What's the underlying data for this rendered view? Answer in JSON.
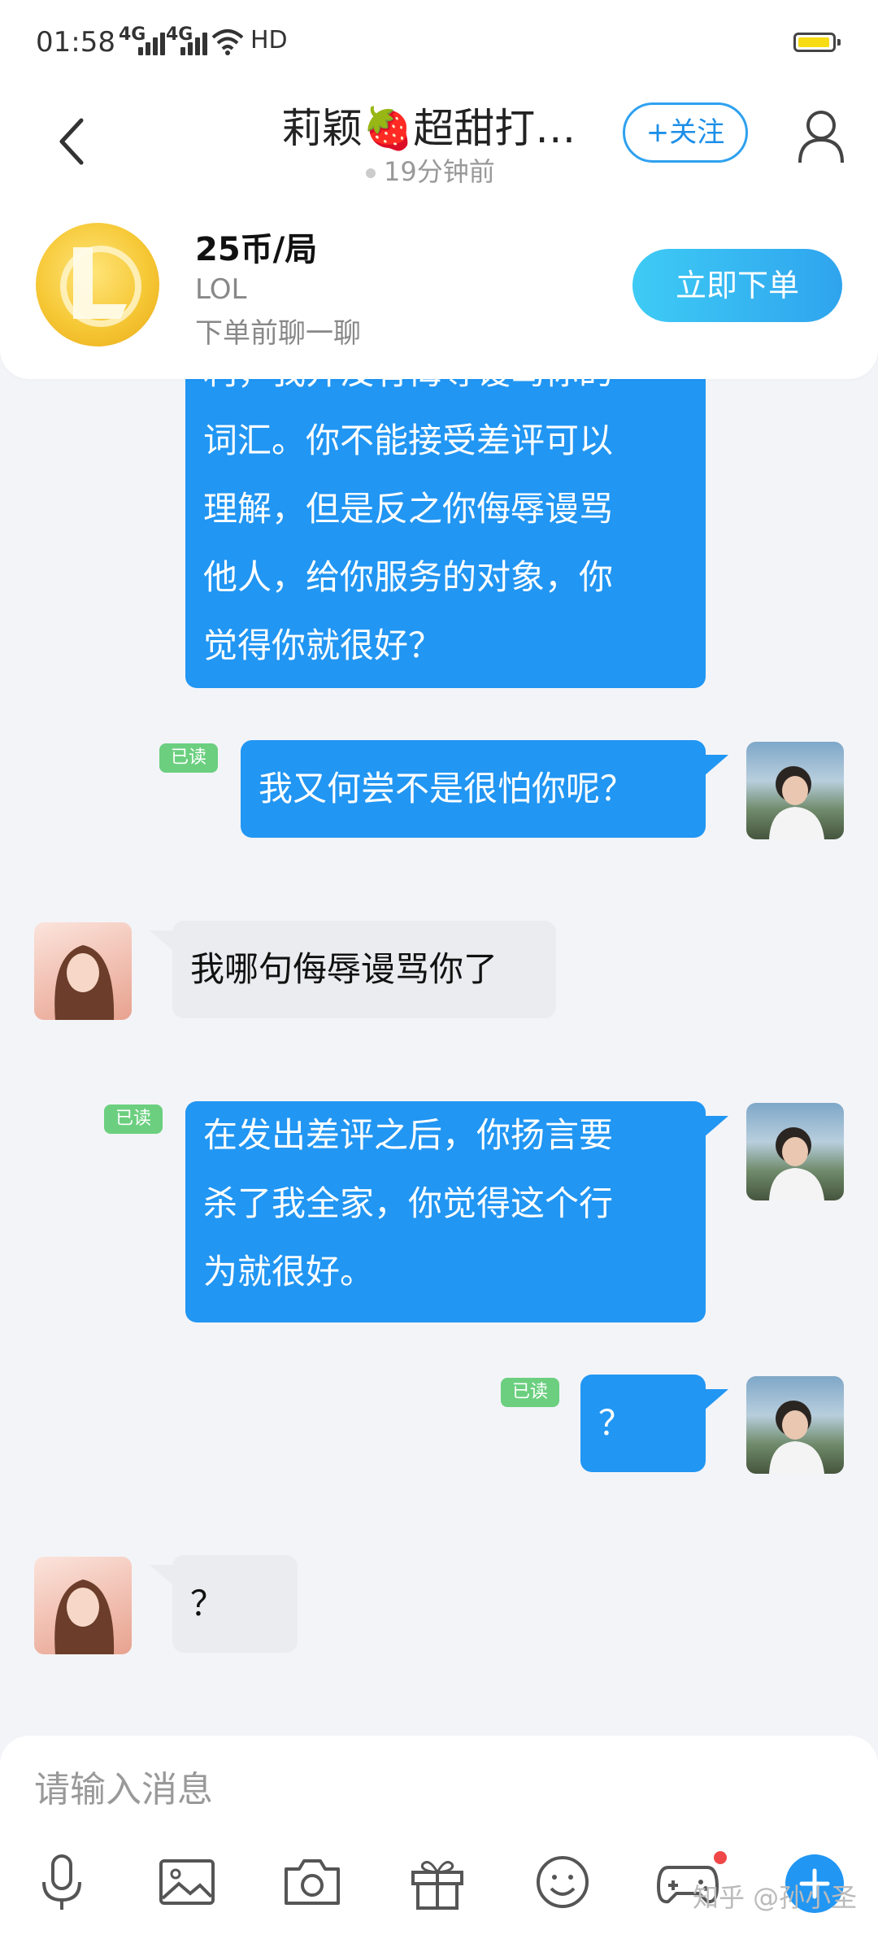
{
  "status_bar": {
    "time": "01:58",
    "network_1": "4G",
    "network_2": "4G",
    "hd": "HD"
  },
  "header": {
    "title": "莉颖🍓超甜打…",
    "last_seen": "19分钟前",
    "follow_label": "+关注"
  },
  "order_card": {
    "price": "25币/局",
    "game": "LOL",
    "hint": "下单前聊一聊",
    "order_button": "立即下单"
  },
  "messages": [
    {
      "sender": "me",
      "lines": [
        "利，我并没有侮辱谩骂你的",
        "词汇。你不能接受差评可以",
        "理解，但是反之你侮辱谩骂",
        "他人，给你服务的对象，你",
        "觉得你就很好？"
      ]
    },
    {
      "sender": "me",
      "read": "已读",
      "lines": [
        "我又何尝不是很怕你呢？"
      ]
    },
    {
      "sender": "other",
      "lines": [
        "我哪句侮辱谩骂你了"
      ]
    },
    {
      "sender": "me",
      "read": "已读",
      "lines": [
        "在发出差评之后，你扬言要",
        "杀了我全家，你觉得这个行",
        "为就很好。"
      ]
    },
    {
      "sender": "me",
      "read": "已读",
      "lines": [
        "？"
      ]
    },
    {
      "sender": "other",
      "lines": [
        "？"
      ]
    }
  ],
  "input_bar": {
    "placeholder": "请输入消息",
    "tools": [
      "microphone-icon",
      "image-icon",
      "camera-icon",
      "gift-icon",
      "emoji-icon",
      "gamepad-icon",
      "plus-icon"
    ],
    "watermark": "知乎 @孙小圣"
  },
  "colors": {
    "my_bubble": "#2196f3",
    "other_bubble": "#ebecef",
    "read_badge": "#6bcf7f",
    "accent": "#2ea1f0"
  }
}
